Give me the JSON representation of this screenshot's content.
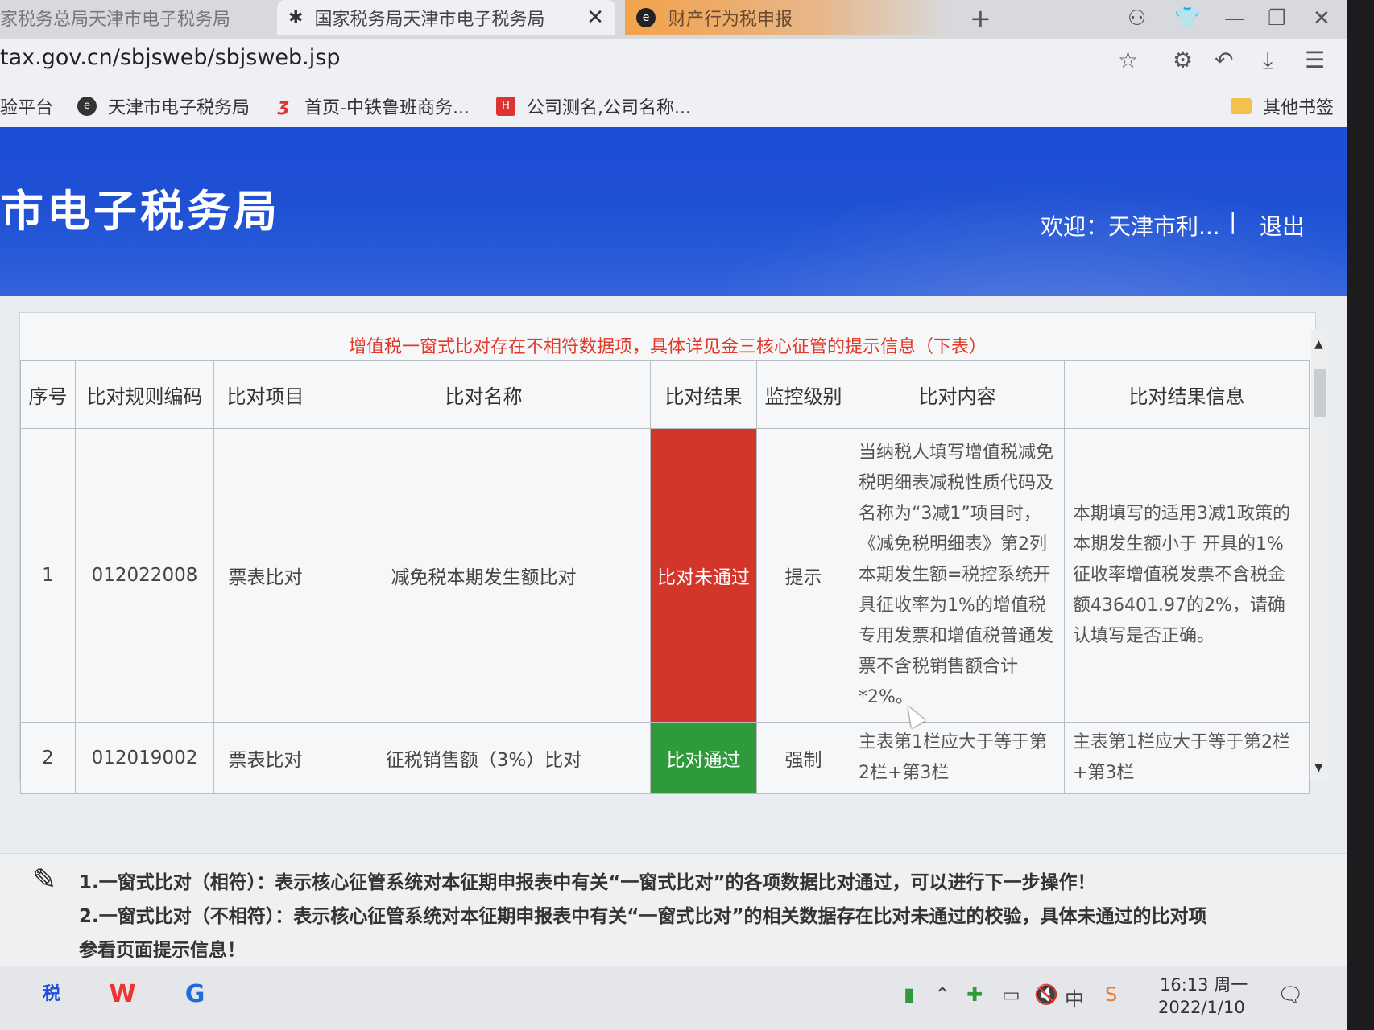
{
  "browser": {
    "tabs": [
      {
        "label": "家税务总局天津市电子税务局"
      },
      {
        "label": "国家税务局天津市电子税务局",
        "icon": "tax-logo-icon",
        "close": "✕"
      },
      {
        "label": "财产行为税申报",
        "icon": "e-browser-icon"
      }
    ],
    "new_tab": "+",
    "url": "tax.gov.cn/sbjsweb/sbjsweb.jsp",
    "bookmarks": [
      {
        "label": "验平台"
      },
      {
        "label": "天津市电子税务局",
        "icon": "e-browser-icon"
      },
      {
        "label": "首页-中铁鲁班商务...",
        "icon": "zhongtie-icon"
      },
      {
        "label": "公司测名,公司名称...",
        "icon": "red-square-icon"
      }
    ],
    "other_bookmarks": "其他书签"
  },
  "site": {
    "title": "市电子税务局",
    "welcome": "欢迎：天津市利...",
    "separator": "|",
    "logout": "退出"
  },
  "comparison": {
    "notice": "增值税一窗式比对存在不相符数据项，具体详见金三核心征管的提示信息（下表）",
    "headers": [
      "序号",
      "比对规则编码",
      "比对项目",
      "比对名称",
      "比对结果",
      "监控级别",
      "比对内容",
      "比对结果信息"
    ],
    "rows": [
      {
        "no": "1",
        "code": "012022008",
        "item": "票表比对",
        "name": "减免税本期发生额比对",
        "result": "比对未通过",
        "level": "提示",
        "content": "当纳税人填写增值税减免税明细表减税性质代码及名称为“3减1”项目时，《减免税明细表》第2列本期发生额=税控系统开具征收率为1%的增值税专用发票和增值税普通发票不含税销售额合计*2%。",
        "message": "本期填写的适用3减1政策的本期发生额小于 开具的1%征收率增值税发票不含税金额436401.97的2%，请确认填写是否正确。"
      },
      {
        "no": "2",
        "code": "012019002",
        "item": "票表比对",
        "name": "征税销售额（3%）比对",
        "result": "比对通过",
        "level": "强制",
        "content": "主表第1栏应大于等于第2栏+第3栏",
        "message": "主表第1栏应大于等于第2栏+第3栏"
      }
    ]
  },
  "tips": [
    "1.一窗式比对（相符）：表示核心征管系统对本征期申报表中有关“一窗式比对”的各项数据比对通过，可以进行下一步操作！",
    "2.一窗式比对（不相符）：表示核心征管系统对本征期申报表中有关“一窗式比对”的相关数据存在比对未通过的校验，具体未通过的比对项",
    "参看页面提示信息！"
  ],
  "taskbar": {
    "time": "16:13 周一",
    "date": "2022/1/10",
    "ime": "中",
    "notifications": "1"
  },
  "colors": {
    "fail": "#d2362b",
    "pass": "#2f9a3b",
    "notice": "#e23a2a",
    "header_blue": "#1e4fd4"
  }
}
